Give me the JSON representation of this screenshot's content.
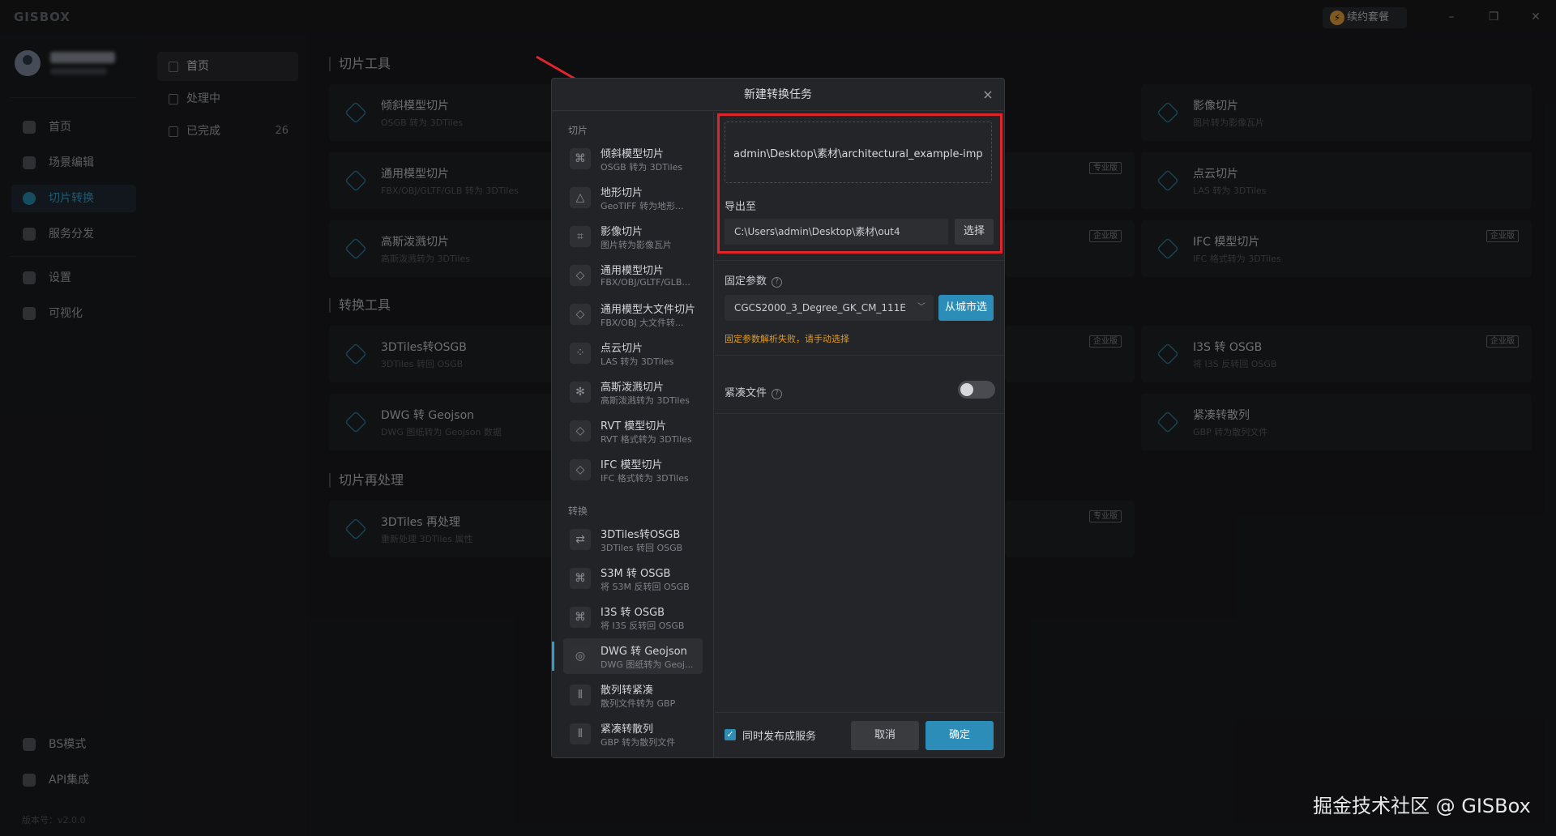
{
  "app": {
    "logo": "GISBOX",
    "renew": "续约套餐",
    "version": "版本号：v2.0.0"
  },
  "window_controls": {
    "minimize": "–",
    "maximize": "❐",
    "close": "✕"
  },
  "sidebar": {
    "items": [
      {
        "label": "首页"
      },
      {
        "label": "场景编辑"
      },
      {
        "label": "切片转换"
      },
      {
        "label": "服务分发"
      },
      {
        "label": "设置"
      },
      {
        "label": "可视化"
      }
    ],
    "bottom": [
      {
        "label": "BS模式"
      },
      {
        "label": "API集成"
      }
    ]
  },
  "subnav": {
    "items": [
      {
        "label": "首页"
      },
      {
        "label": "处理中"
      },
      {
        "label": "已完成",
        "count": "26"
      }
    ]
  },
  "content": {
    "sections": [
      "切片工具",
      "转换工具",
      "切片再处理"
    ],
    "cards": [
      {
        "title": "倾斜模型切片",
        "sub": "OSGB 转为 3DTiles"
      },
      {
        "title": "影像切片",
        "sub": "图片转为影像瓦片"
      },
      {
        "title": "通用模型切片",
        "sub": "FBX/OBJ/GLTF/GLB 转为 3DTiles"
      },
      {
        "title": "点云切片",
        "sub": "LAS 转为 3DTiles"
      },
      {
        "title": "高斯泼溅切片",
        "sub": "高斯泼溅转为 3DTiles"
      },
      {
        "title": "IFC 模型切片",
        "sub": "IFC 格式转为 3DTiles"
      },
      {
        "title": "3DTiles转OSGB",
        "sub": "3DTiles 转回 OSGB"
      },
      {
        "title": "I3S 转 OSGB",
        "sub": "将 I3S 反转回 OSGB"
      },
      {
        "title": "DWG 转 Geojson",
        "sub": "DWG 图纸转为 Geojson 数据"
      },
      {
        "title": "紧凑转散列",
        "sub": "GBP 转为散列文件"
      },
      {
        "title": "3DTiles 再处理",
        "sub": "重新处理 3DTiles 属性"
      }
    ],
    "badges": [
      "专业版",
      "企业版",
      "企业版",
      "企业版",
      "企业版",
      "专业版"
    ]
  },
  "modal": {
    "title": "新建转换任务",
    "close": "×",
    "groups": [
      "切片",
      "转换"
    ],
    "tools": [
      {
        "title": "倾斜模型切片",
        "sub": "OSGB 转为 3DTiles"
      },
      {
        "title": "地形切片",
        "sub": "GeoTIFF 转为地形..."
      },
      {
        "title": "影像切片",
        "sub": "图片转为影像瓦片"
      },
      {
        "title": "通用模型切片",
        "sub": "FBX/OBJ/GLTF/GLB..."
      },
      {
        "title": "通用模型大文件切片",
        "sub": "FBX/OBJ 大文件转..."
      },
      {
        "title": "点云切片",
        "sub": "LAS 转为 3DTiles"
      },
      {
        "title": "高斯泼溅切片",
        "sub": "高斯泼溅转为 3DTiles"
      },
      {
        "title": "RVT 模型切片",
        "sub": "RVT 格式转为 3DTiles"
      },
      {
        "title": "IFC 模型切片",
        "sub": "IFC 格式转为 3DTiles"
      },
      {
        "title": "3DTiles转OSGB",
        "sub": "3DTiles 转回 OSGB"
      },
      {
        "title": "S3M 转 OSGB",
        "sub": "将 S3M 反转回 OSGB"
      },
      {
        "title": "I3S 转 OSGB",
        "sub": "将 I3S 反转回 OSGB"
      },
      {
        "title": "DWG 转 Geojson",
        "sub": "DWG 图纸转为 Geoj..."
      },
      {
        "title": "散列转紧凑",
        "sub": "散列文件转为 GBP"
      },
      {
        "title": "紧凑转散列",
        "sub": "GBP 转为散列文件"
      }
    ],
    "input_path": "admin\\Desktop\\素材\\architectural_example-imp",
    "export_label": "导出至",
    "export_value": "C:\\Users\\admin\\Desktop\\素材\\out4",
    "select_button": "选择",
    "fixed_params_label": "固定参数",
    "crs_value": "CGCS2000_3_Degree_GK_CM_111E",
    "city_button": "从城市选",
    "warning": "固定参数解析失败，请手动选择",
    "compact_label": "紧凑文件",
    "publish_label": "同时发布成服务",
    "cancel": "取消",
    "ok": "确定"
  },
  "watermark": "掘金技术社区 @ GISBox"
}
